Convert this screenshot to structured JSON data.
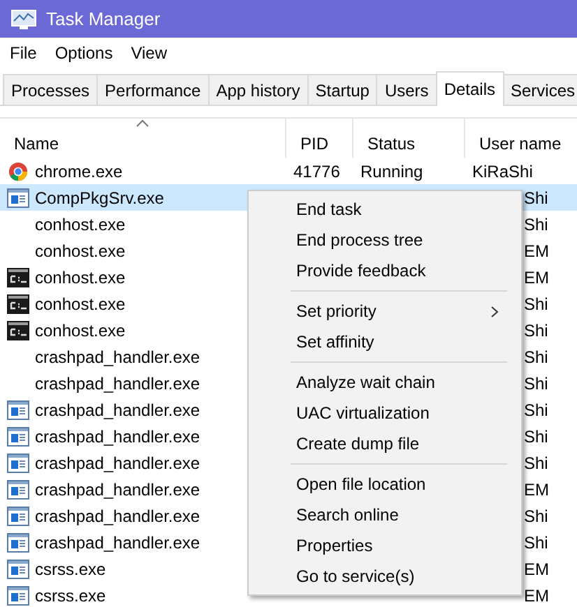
{
  "window": {
    "title": "Task Manager"
  },
  "menu_bar": [
    "File",
    "Options",
    "View"
  ],
  "tabs": [
    {
      "label": "Processes",
      "selected": false
    },
    {
      "label": "Performance",
      "selected": false
    },
    {
      "label": "App history",
      "selected": false
    },
    {
      "label": "Startup",
      "selected": false
    },
    {
      "label": "Users",
      "selected": false
    },
    {
      "label": "Details",
      "selected": true
    },
    {
      "label": "Services",
      "selected": false
    }
  ],
  "table": {
    "columns": [
      {
        "label": "Name",
        "sorted": true
      },
      {
        "label": "PID",
        "sorted": false
      },
      {
        "label": "Status",
        "sorted": false
      },
      {
        "label": "User name",
        "sorted": false
      }
    ],
    "rows": [
      {
        "kind": "browser",
        "name": "chrome.exe",
        "pid": "41776",
        "status": "Running",
        "user_name": "KiRaShi",
        "selected": false,
        "covered": false
      },
      {
        "kind": "window",
        "name": "CompPkgSrv.exe",
        "user_name": "Shi",
        "selected": true,
        "covered": true
      },
      {
        "kind": "none",
        "name": "conhost.exe",
        "user_name": "Shi",
        "selected": false,
        "covered": true
      },
      {
        "kind": "none",
        "name": "conhost.exe",
        "user_name": "EM",
        "selected": false,
        "covered": true
      },
      {
        "kind": "console",
        "name": "conhost.exe",
        "user_name": "EM",
        "selected": false,
        "covered": true
      },
      {
        "kind": "console",
        "name": "conhost.exe",
        "user_name": "Shi",
        "selected": false,
        "covered": true
      },
      {
        "kind": "console",
        "name": "conhost.exe",
        "user_name": "Shi",
        "selected": false,
        "covered": true
      },
      {
        "kind": "none",
        "name": "crashpad_handler.exe",
        "user_name": "Shi",
        "selected": false,
        "covered": true
      },
      {
        "kind": "none",
        "name": "crashpad_handler.exe",
        "user_name": "Shi",
        "selected": false,
        "covered": true
      },
      {
        "kind": "window",
        "name": "crashpad_handler.exe",
        "user_name": "Shi",
        "selected": false,
        "covered": true
      },
      {
        "kind": "window",
        "name": "crashpad_handler.exe",
        "user_name": "Shi",
        "selected": false,
        "covered": true
      },
      {
        "kind": "window",
        "name": "crashpad_handler.exe",
        "user_name": "Shi",
        "selected": false,
        "covered": true
      },
      {
        "kind": "window",
        "name": "crashpad_handler.exe",
        "user_name": "EM",
        "selected": false,
        "covered": true
      },
      {
        "kind": "window",
        "name": "crashpad_handler.exe",
        "user_name": "Shi",
        "selected": false,
        "covered": true
      },
      {
        "kind": "window",
        "name": "crashpad_handler.exe",
        "user_name": "Shi",
        "selected": false,
        "covered": true
      },
      {
        "kind": "window",
        "name": "csrss.exe",
        "user_name": "EM",
        "selected": false,
        "covered": true
      },
      {
        "kind": "window",
        "name": "csrss.exe",
        "user_name": "EM",
        "selected": false,
        "covered": true
      }
    ]
  },
  "context_menu": {
    "groups": [
      [
        {
          "label": "End task",
          "submenu": false
        },
        {
          "label": "End process tree",
          "submenu": false
        },
        {
          "label": "Provide feedback",
          "submenu": false
        }
      ],
      [
        {
          "label": "Set priority",
          "submenu": true
        },
        {
          "label": "Set affinity",
          "submenu": false
        }
      ],
      [
        {
          "label": "Analyze wait chain",
          "submenu": false
        },
        {
          "label": "UAC virtualization",
          "submenu": false
        },
        {
          "label": "Create dump file",
          "submenu": false
        }
      ],
      [
        {
          "label": "Open file location",
          "submenu": false
        },
        {
          "label": "Search online",
          "submenu": false
        },
        {
          "label": "Properties",
          "submenu": false
        },
        {
          "label": "Go to service(s)",
          "submenu": false
        }
      ]
    ]
  }
}
